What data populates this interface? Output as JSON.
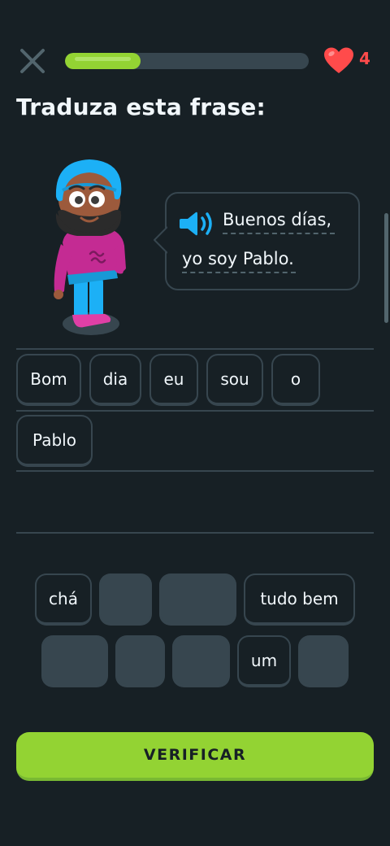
{
  "header": {
    "progress": 0.31,
    "hearts": "4",
    "colors": {
      "progress": "#93d333",
      "heart": "#ff4b4b"
    }
  },
  "prompt": {
    "title": "Traduza esta frase:"
  },
  "bubble": {
    "line1": "Buenos días,",
    "line2": "yo soy Pablo.",
    "speaker_icon": "speaker-icon"
  },
  "answer": {
    "row1": [
      "Bom",
      "dia",
      "eu",
      "sou",
      "o"
    ],
    "row2": [
      "Pablo"
    ]
  },
  "word_bank": {
    "row1": [
      "chá",
      "",
      "",
      "tudo bem"
    ],
    "row2": [
      "",
      "",
      "",
      "um",
      ""
    ]
  },
  "footer": {
    "verify_label": "VERIFICAR"
  },
  "colors": {
    "background": "#172025",
    "accent": "#93d333",
    "tile_border": "#37464f"
  }
}
